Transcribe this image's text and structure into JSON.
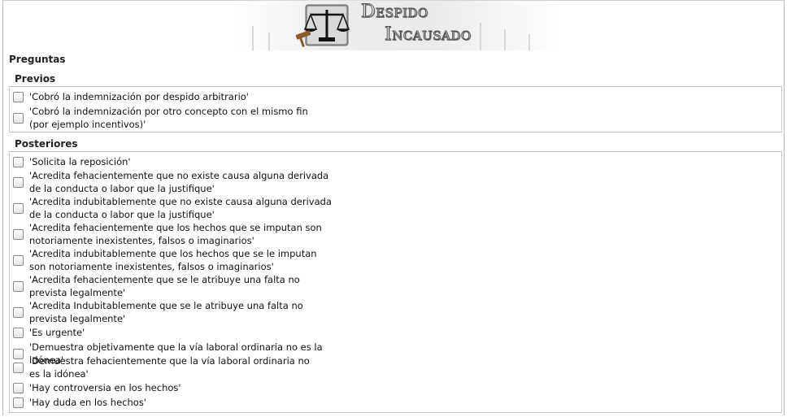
{
  "banner": {
    "title_line1": "Despido",
    "title_line2": "Incausado"
  },
  "questions_section": {
    "label": "Preguntas"
  },
  "previos": {
    "label": "Previos",
    "items": [
      {
        "text": "'Cobró la indemnización por despido arbitrario'",
        "checked": false
      },
      {
        "text": "'Cobró la indemnización por otro concepto con el mismo fin (por ejemplo incentivos)'",
        "checked": false
      }
    ]
  },
  "posteriores": {
    "label": "Posteriores",
    "items": [
      {
        "text": "'Solicita la reposición'",
        "checked": false
      },
      {
        "text": "'Acredita fehacientemente que no existe causa alguna derivada de la conducta o labor que la justifique'",
        "checked": false
      },
      {
        "text": "'Acredita indubitablemente que no existe causa alguna derivada de la conducta o labor que la justifique'",
        "checked": false
      },
      {
        "text": "'Acredita fehacientemente que los hechos que se imputan son notoriamente inexistentes, falsos o imaginarios'",
        "checked": false
      },
      {
        "text": "'Acredita indubitablemente que los hechos que se le imputan son notoriamente inexistentes, falsos o imaginarios'",
        "checked": false
      },
      {
        "text": "'Acredita fehacientemente que se le atribuye una falta no prevista legalmente'",
        "checked": false
      },
      {
        "text": "'Acredita Indubitablemente que se le atribuye una falta no prevista legalmente'",
        "checked": false
      },
      {
        "text": "'Es urgente'",
        "checked": false
      },
      {
        "text": "'Demuestra objetivamente que la vía laboral ordinaria no es la idónea'",
        "checked": false
      },
      {
        "text": "'Demuestra fehacientemente que la vía laboral ordinaria no es la idónea'",
        "checked": false
      },
      {
        "text": "'Hay controversia en los hechos'",
        "checked": false
      },
      {
        "text": "'Hay duda en los hechos'",
        "checked": false
      }
    ]
  }
}
